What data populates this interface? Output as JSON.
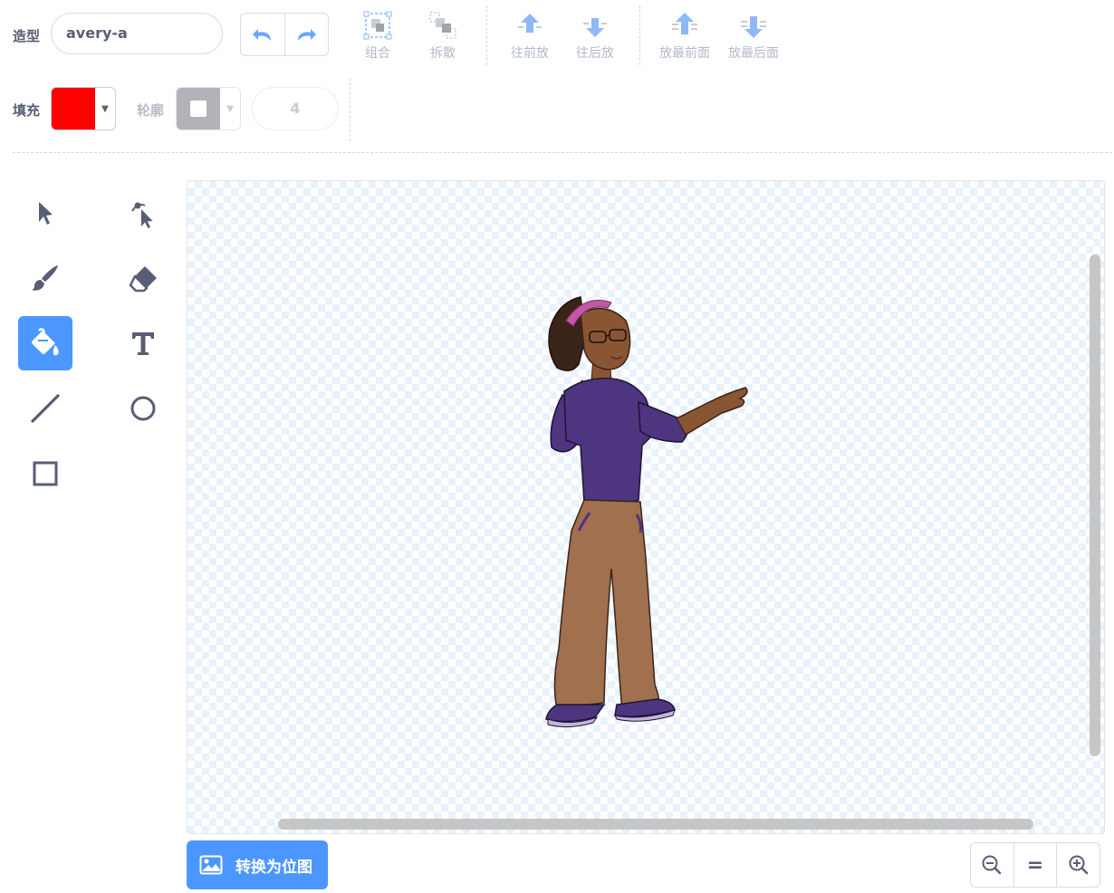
{
  "costume": {
    "label": "造型",
    "name": "avery-a"
  },
  "toolbar": {
    "group": "组合",
    "ungroup": "拆散",
    "forward": "往前放",
    "backward": "往后放",
    "front": "放最前面",
    "back": "放最后面"
  },
  "fill": {
    "label": "填充",
    "color": "#ff0000"
  },
  "outline": {
    "label": "轮廓",
    "color": "#b2b3b8",
    "width": "4"
  },
  "tools": [
    "select-tool",
    "reshape-tool",
    "brush-tool",
    "eraser-tool",
    "fill-tool",
    "text-tool",
    "line-tool",
    "circle-tool",
    "rectangle-tool"
  ],
  "active_tool": "fill-tool",
  "convert": {
    "label": "转换为位图"
  },
  "zoom": {
    "out": "−",
    "reset": "=",
    "in": "+"
  },
  "colors": {
    "accent": "#4c97ff",
    "text": "#575e75",
    "disabled": "#b2b9c8"
  }
}
